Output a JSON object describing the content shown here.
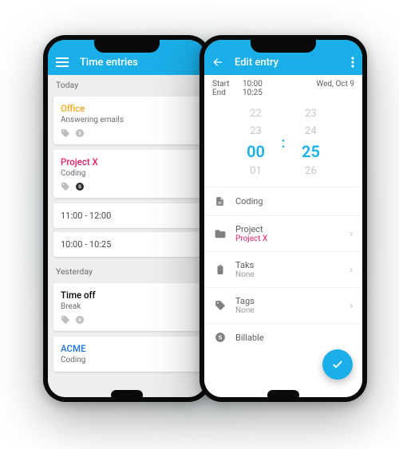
{
  "left": {
    "title": "Time entries",
    "sections": {
      "today": "Today",
      "yesterday": "Yesterday"
    },
    "entries": {
      "office": {
        "title": "Office",
        "subtitle": "Answering emails"
      },
      "projectx": {
        "title": "Project X",
        "subtitle": "Coding"
      },
      "slot1": "11:00 - 12:00",
      "slot2": "10:00 - 10:25",
      "timeoff": {
        "title": "Time off",
        "subtitle": "Break"
      },
      "acme": {
        "title": "ACME",
        "subtitle": "Coding"
      }
    }
  },
  "right": {
    "title": "Edit entry",
    "start_label": "Start",
    "end_label": "End",
    "start_time": "10:00",
    "end_time": "10:25",
    "date": "Wed, Oct 9",
    "picker": {
      "h_minus2": "22",
      "h_minus1": "23",
      "h_sel": "00",
      "h_plus1": "01",
      "m_minus2": "23",
      "m_minus1": "24",
      "m_sel": "25",
      "m_plus1": "26",
      "colon": ":"
    },
    "rows": {
      "description": "Coding",
      "project_label": "Project",
      "project_value": "Project X",
      "task_label": "Taks",
      "task_value": "None",
      "tags_label": "Tags",
      "tags_value": "None",
      "billable_label": "Billable"
    }
  },
  "colors": {
    "brand": "#1aafe9",
    "orange": "#f5a623",
    "magenta": "#e91e63",
    "blue": "#1a73e8"
  }
}
